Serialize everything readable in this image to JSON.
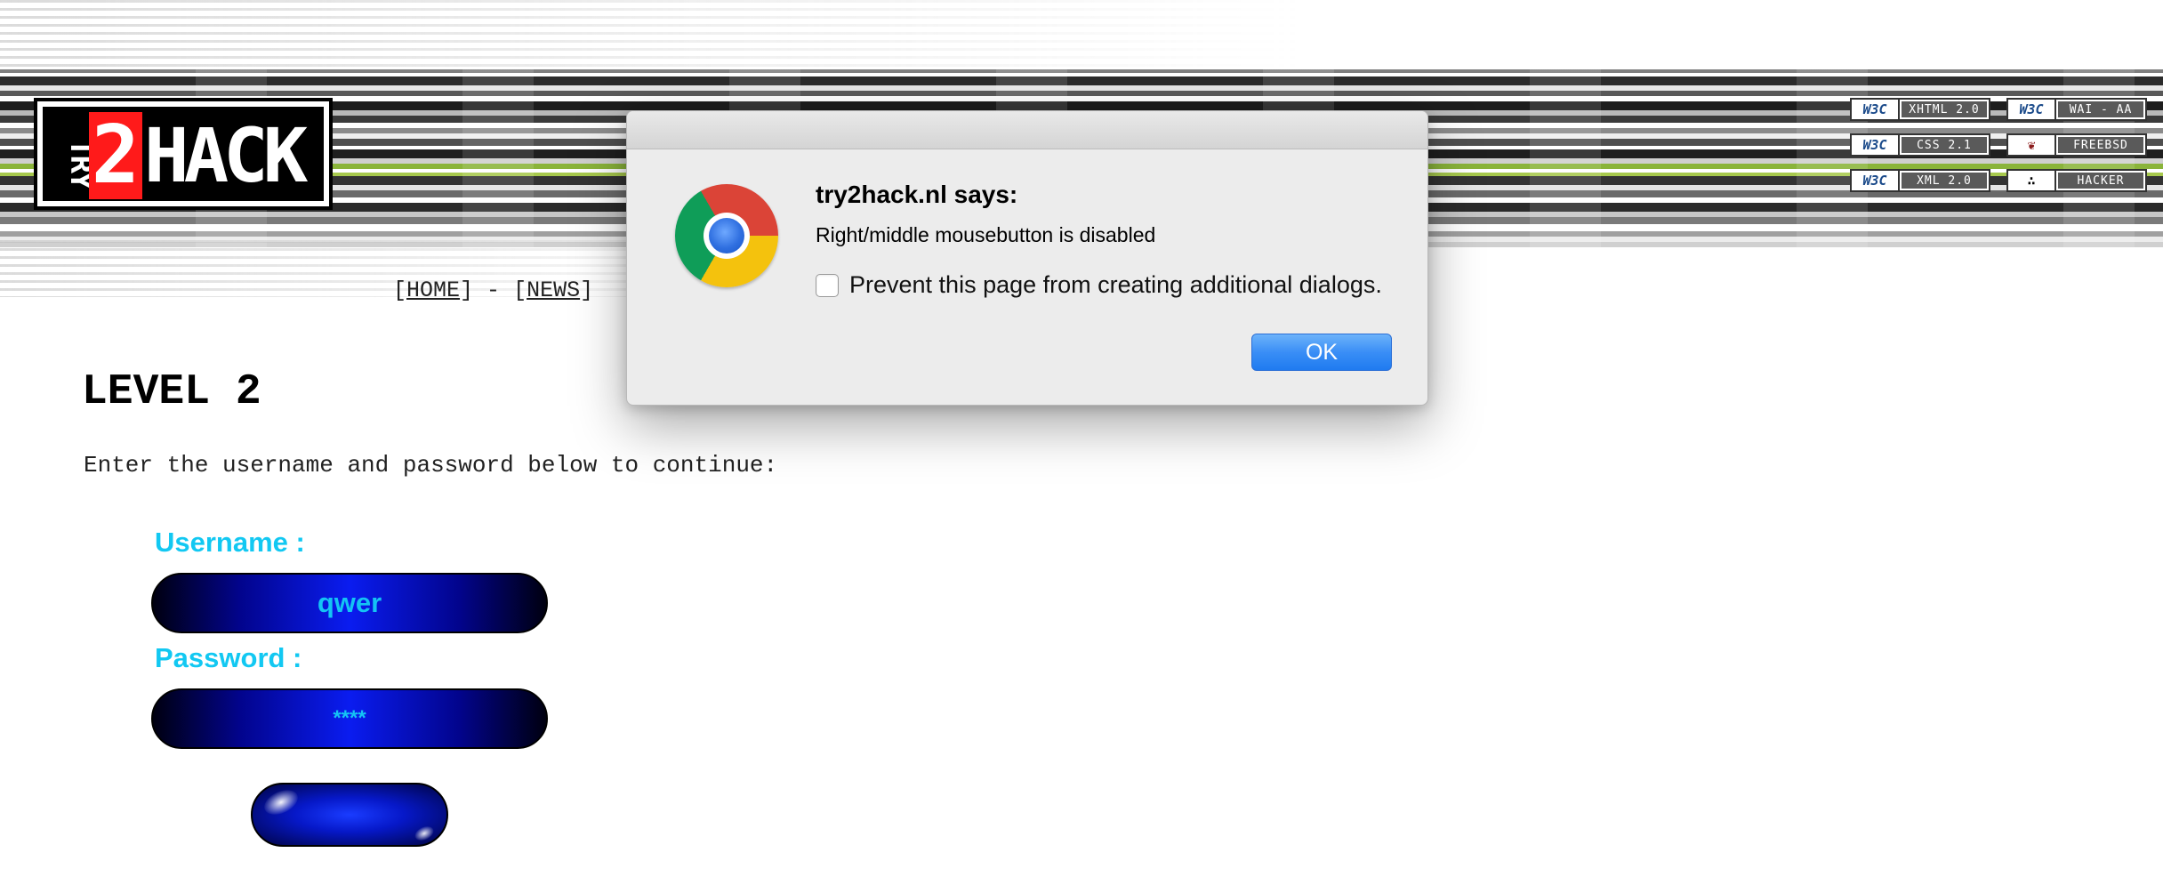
{
  "site": {
    "logo": {
      "part1": "TRY",
      "part2": "2",
      "part3": "HACK"
    },
    "badges": [
      {
        "icon": "W3C",
        "label": "XHTML 2.0"
      },
      {
        "icon": "W3C",
        "label": "WAI - AA"
      },
      {
        "icon": "W3C",
        "label": "CSS 2.1"
      },
      {
        "icon": "❦",
        "label": "FREEBSD"
      },
      {
        "icon": "W3C",
        "label": "XML 2.0"
      },
      {
        "icon": "∴",
        "label": "HACKER"
      }
    ],
    "nav": {
      "open1": "[",
      "home": "HOME",
      "close1": "]",
      "sep": " - ",
      "open2": "[",
      "news": "NEWS",
      "close2": "]"
    }
  },
  "content": {
    "title": "LEVEL 2",
    "intro": "Enter the username and password below to continue:",
    "username_label": "Username :",
    "username_value": "qwer",
    "password_label": "Password :",
    "password_mask": "****"
  },
  "dialog": {
    "title": "try2hack.nl says:",
    "message": "Right/middle mousebutton is disabled",
    "checkbox_label": "Prevent this page from creating additional dialogs.",
    "checkbox_checked": false,
    "ok_label": "OK",
    "icon": "chrome-icon"
  }
}
